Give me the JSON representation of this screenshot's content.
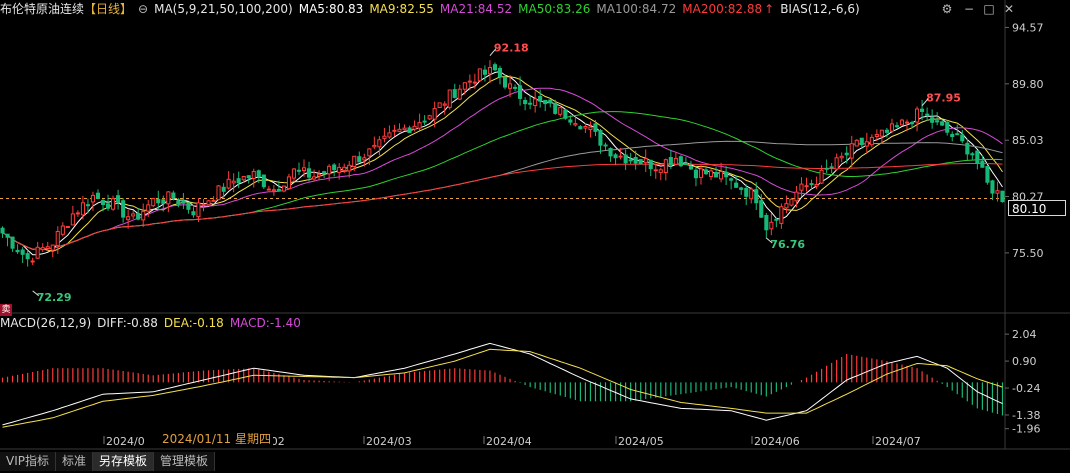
{
  "header": {
    "title": "布伦特原油连续",
    "period": "【日线】",
    "ma_def": "MA(5,9,21,50,100,200)",
    "ma5": "MA5:80.83",
    "ma9": "MA9:82.55",
    "ma21": "MA21:84.52",
    "ma50": "MA50:83.26",
    "ma100": "MA100:84.72",
    "ma200": "MA200:82.88",
    "bias": "BIAS(12,-6,6)"
  },
  "macd_header": {
    "def": "MACD(26,12,9)",
    "diff": "DIFF:-0.88",
    "dea": "DEA:-0.18",
    "macd": "MACD:-1.40"
  },
  "current_price": "80.10",
  "sell_badge": "卖",
  "date_tooltip": "2024/01/11 星期四",
  "tabs": [
    {
      "label": "VIP指标",
      "active": false
    },
    {
      "label": "标准",
      "active": false
    },
    {
      "label": "另存模板",
      "active": true
    },
    {
      "label": "管理模板",
      "active": false
    }
  ],
  "colors": {
    "up": "#ff3b3b",
    "down": "#17b978",
    "ma5": "#ffffff",
    "ma9": "#f4e04d",
    "ma21": "#d64ad6",
    "ma50": "#2fd12f",
    "ma100": "#9a9a9a",
    "ma200": "#ff3b3b",
    "label_up": "#ff4d4d",
    "label_down": "#3ac77c"
  },
  "chart_data": [
    {
      "type": "candlestick",
      "title": "布伦特原油连续 日线",
      "x_labels": [
        "2024/0",
        "4/02",
        "2024/03",
        "2024/04",
        "2024/05",
        "2024/06",
        "2024/07"
      ],
      "y_ticks": [
        94.57,
        89.8,
        85.03,
        80.27,
        75.5
      ],
      "ylim": [
        70.5,
        95.2
      ],
      "annotations": [
        {
          "label": "92.18",
          "value": 92.18,
          "kind": "high"
        },
        {
          "label": "87.95",
          "value": 87.95,
          "kind": "high"
        },
        {
          "label": "76.76",
          "value": 76.76,
          "kind": "low"
        },
        {
          "label": "72.29",
          "value": 72.29,
          "kind": "low"
        }
      ],
      "reference_line": 80.1,
      "close_path": [
        [
          0,
          77.2
        ],
        [
          5,
          75.0
        ],
        [
          10,
          76.4
        ],
        [
          14,
          78.8
        ],
        [
          18,
          80.3
        ],
        [
          22,
          79.6
        ],
        [
          26,
          78.3
        ],
        [
          30,
          79.9
        ],
        [
          34,
          80.2
        ],
        [
          38,
          79.1
        ],
        [
          42,
          80.4
        ],
        [
          46,
          81.6
        ],
        [
          50,
          82.1
        ],
        [
          54,
          80.9
        ],
        [
          58,
          82.4
        ],
        [
          62,
          82.0
        ],
        [
          66,
          82.6
        ],
        [
          70,
          83.4
        ],
        [
          74,
          84.2
        ],
        [
          78,
          85.6
        ],
        [
          82,
          86.4
        ],
        [
          86,
          87.5
        ],
        [
          90,
          89.2
        ],
        [
          94,
          90.4
        ],
        [
          98,
          90.9
        ],
        [
          102,
          89.0
        ],
        [
          106,
          88.3
        ],
        [
          110,
          87.6
        ],
        [
          114,
          86.9
        ],
        [
          118,
          85.4
        ],
        [
          122,
          83.8
        ],
        [
          126,
          83.4
        ],
        [
          130,
          82.9
        ],
        [
          134,
          83.6
        ],
        [
          138,
          82.4
        ],
        [
          142,
          82.1
        ],
        [
          146,
          81.3
        ],
        [
          150,
          80.2
        ],
        [
          152,
          77.8
        ],
        [
          155,
          79.3
        ],
        [
          158,
          80.6
        ],
        [
          162,
          81.7
        ],
        [
          166,
          83.1
        ],
        [
          170,
          84.6
        ],
        [
          174,
          85.2
        ],
        [
          178,
          86.1
        ],
        [
          181,
          86.9
        ],
        [
          183,
          87.4
        ],
        [
          186,
          86.3
        ],
        [
          190,
          85.1
        ],
        [
          193,
          84.0
        ],
        [
          196,
          81.3
        ],
        [
          199,
          80.2
        ]
      ],
      "moving_averages": [
        {
          "name": "MA5",
          "value": 80.83
        },
        {
          "name": "MA9",
          "value": 82.55
        },
        {
          "name": "MA21",
          "value": 84.52
        },
        {
          "name": "MA50",
          "value": 83.26
        },
        {
          "name": "MA100",
          "value": 84.72
        },
        {
          "name": "MA200",
          "value": 82.88
        }
      ]
    },
    {
      "type": "bar",
      "title": "MACD(26,12,9)",
      "y_ticks": [
        2.04,
        0.9,
        -0.24,
        -1.38,
        -1.96
      ],
      "ylim": [
        -2.1,
        2.3
      ],
      "diff_last": -0.88,
      "dea_last": -0.18,
      "macd_last": -1.4,
      "diff_path": [
        [
          0,
          -1.8
        ],
        [
          10,
          -1.2
        ],
        [
          20,
          -0.5
        ],
        [
          30,
          -0.4
        ],
        [
          40,
          0.1
        ],
        [
          50,
          0.6
        ],
        [
          60,
          0.3
        ],
        [
          70,
          0.2
        ],
        [
          80,
          0.6
        ],
        [
          90,
          1.2
        ],
        [
          97,
          1.65
        ],
        [
          105,
          1.2
        ],
        [
          115,
          0.2
        ],
        [
          125,
          -0.7
        ],
        [
          135,
          -1.1
        ],
        [
          145,
          -1.2
        ],
        [
          152,
          -1.6
        ],
        [
          160,
          -1.2
        ],
        [
          168,
          0.1
        ],
        [
          176,
          0.8
        ],
        [
          182,
          1.1
        ],
        [
          188,
          0.6
        ],
        [
          194,
          -0.4
        ],
        [
          199,
          -0.9
        ]
      ],
      "dea_path": [
        [
          0,
          -1.9
        ],
        [
          10,
          -1.5
        ],
        [
          20,
          -0.8
        ],
        [
          30,
          -0.55
        ],
        [
          40,
          -0.15
        ],
        [
          50,
          0.3
        ],
        [
          60,
          0.25
        ],
        [
          70,
          0.2
        ],
        [
          80,
          0.4
        ],
        [
          90,
          0.9
        ],
        [
          97,
          1.4
        ],
        [
          105,
          1.3
        ],
        [
          115,
          0.6
        ],
        [
          125,
          -0.3
        ],
        [
          135,
          -0.85
        ],
        [
          145,
          -1.1
        ],
        [
          152,
          -1.3
        ],
        [
          160,
          -1.3
        ],
        [
          168,
          -0.5
        ],
        [
          176,
          0.35
        ],
        [
          182,
          0.8
        ],
        [
          188,
          0.7
        ],
        [
          194,
          0.15
        ],
        [
          199,
          -0.2
        ]
      ]
    }
  ]
}
